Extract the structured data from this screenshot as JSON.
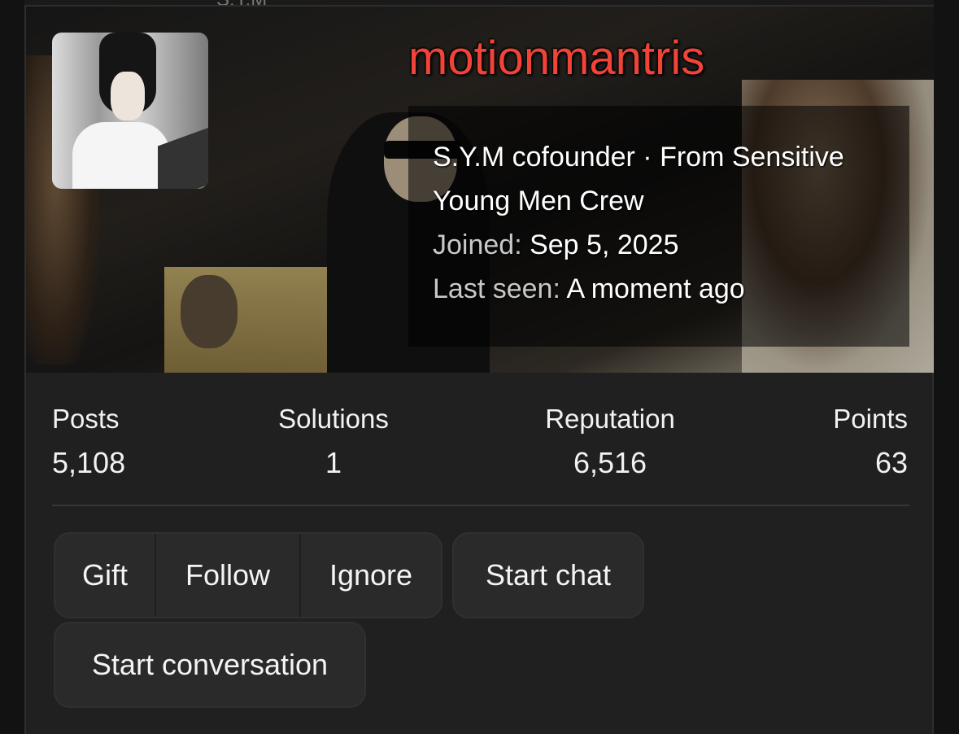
{
  "top_fragment": "S.Y.M",
  "profile": {
    "username": "motionmantris",
    "tagline": "S.Y.M cofounder · From Sensitive Young Men Crew",
    "joined_label": "Joined:",
    "joined_value": "Sep 5, 2025",
    "last_seen_label": "Last seen:",
    "last_seen_value": "A moment ago",
    "username_color": "#f04438"
  },
  "stats": {
    "posts_label": "Posts",
    "posts_value": "5,108",
    "solutions_label": "Solutions",
    "solutions_value": "1",
    "reputation_label": "Reputation",
    "reputation_value": "6,516",
    "points_label": "Points",
    "points_value": "63"
  },
  "actions": {
    "gift": "Gift",
    "follow": "Follow",
    "ignore": "Ignore",
    "start_chat": "Start chat",
    "start_conversation": "Start conversation"
  }
}
